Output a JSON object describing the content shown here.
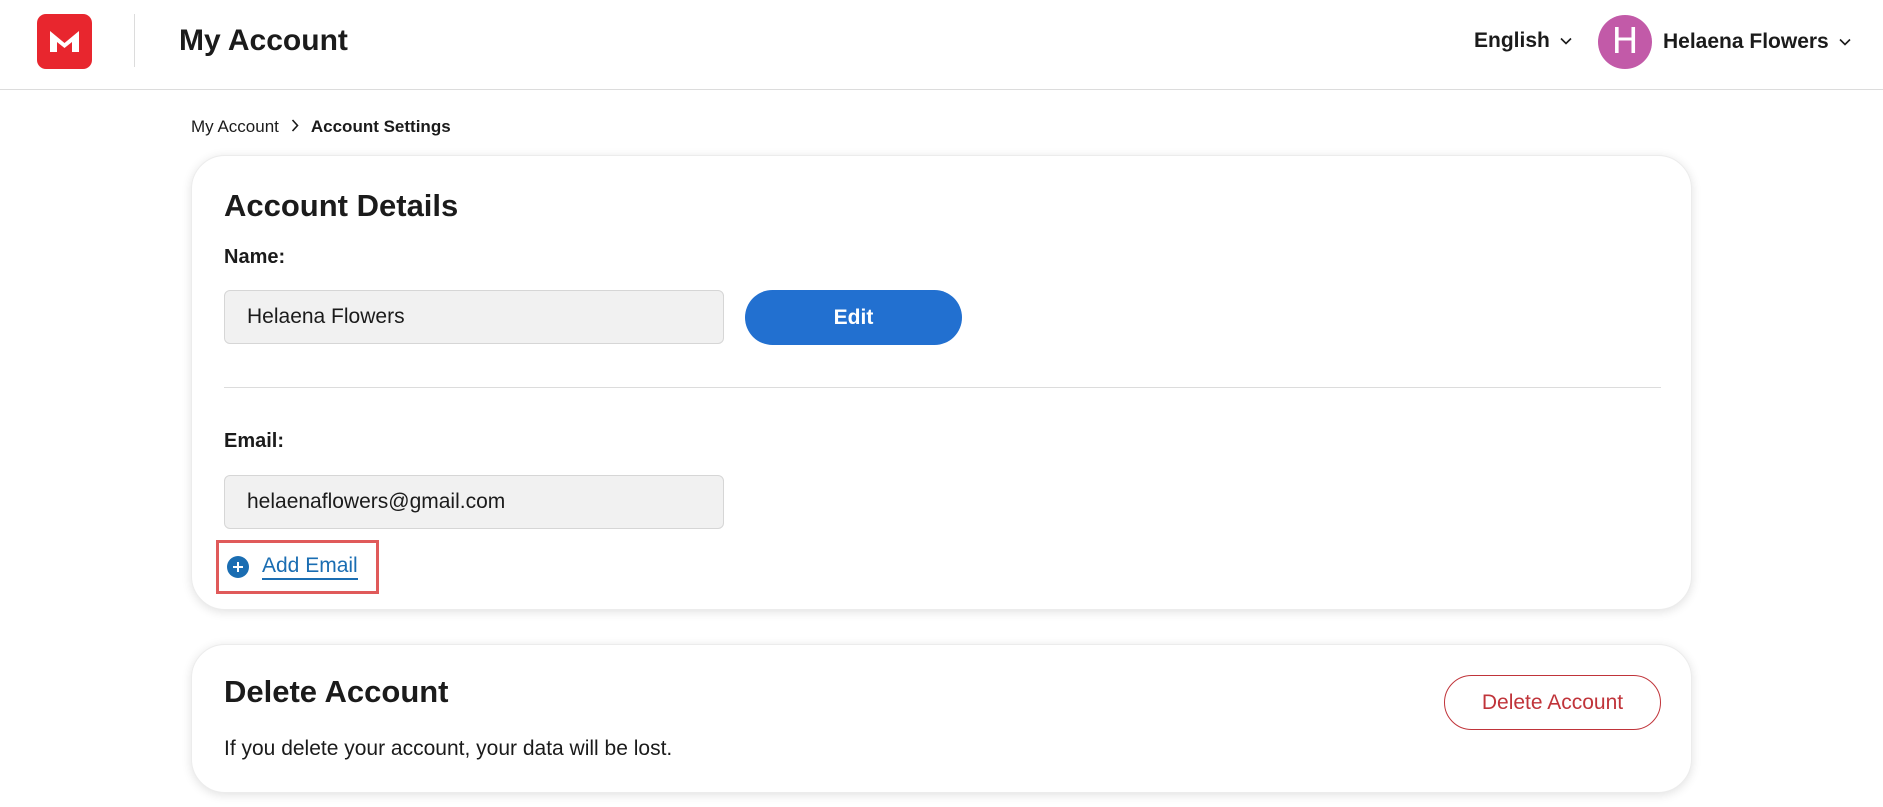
{
  "header": {
    "logo_icon": "envelope-logo-icon",
    "title": "My Account",
    "language": "English",
    "user": {
      "initial": "H",
      "name": "Helaena Flowers",
      "avatar_color": "#c25aa8"
    }
  },
  "breadcrumb": {
    "items": [
      "My Account",
      "Account Settings"
    ]
  },
  "account_details": {
    "heading": "Account Details",
    "name_label": "Name:",
    "name_value": "Helaena Flowers",
    "edit_label": "Edit",
    "email_label": "Email:",
    "email_value": "helaenaflowers@gmail.com",
    "add_email_label": "Add Email"
  },
  "delete_account": {
    "heading": "Delete Account",
    "description": "If you delete your account, your data will be lost.",
    "button_label": "Delete Account"
  },
  "colors": {
    "brand": "#e8262e",
    "primary": "#2270d0",
    "link": "#1a6db2",
    "danger": "#c0343a",
    "highlight": "#e05a5a"
  }
}
